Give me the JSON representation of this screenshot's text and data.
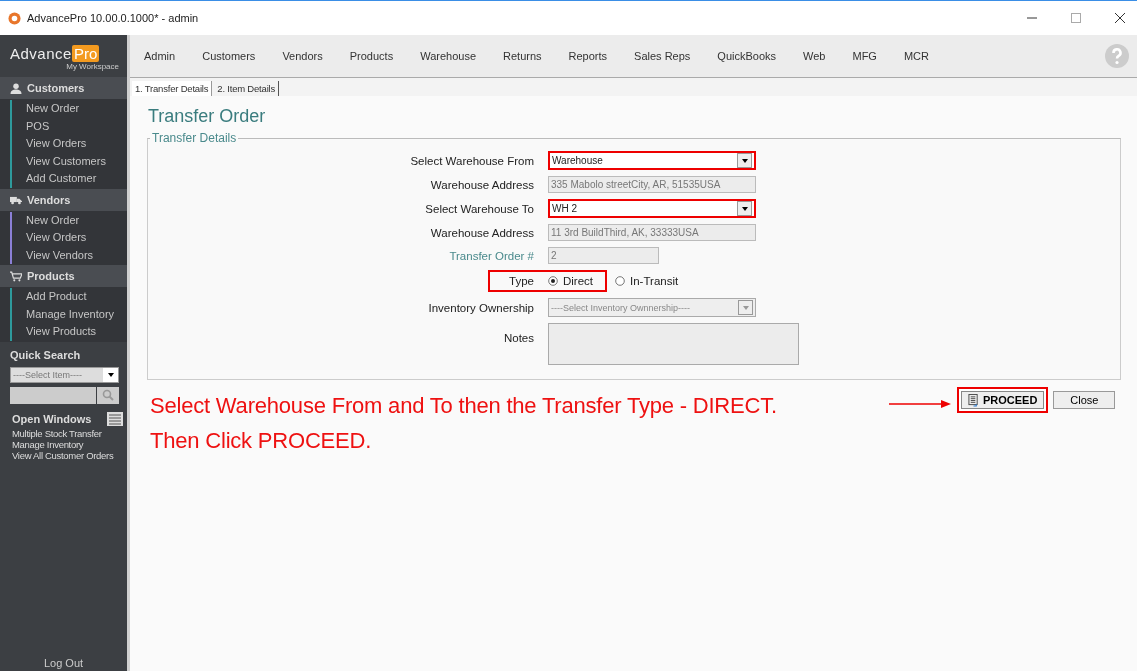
{
  "window": {
    "title": "AdvancePro 10.00.0.1000*  - admin"
  },
  "logo": {
    "word": "Advance",
    "badge": "Pro",
    "subtitle": "My Workspace"
  },
  "sidebar": {
    "sections": [
      {
        "title": "Customers",
        "color": "#2e9a9c",
        "items": [
          "New Order",
          "POS",
          "View Orders",
          "View Customers",
          "Add Customer"
        ]
      },
      {
        "title": "Vendors",
        "color": "#8b7fd6",
        "items": [
          "New Order",
          "View Orders",
          "View Vendors"
        ]
      },
      {
        "title": "Products",
        "color": "#2e9a9c",
        "items": [
          "Add Product",
          "Manage Inventory",
          "View Products"
        ]
      }
    ],
    "quick_search": {
      "title": "Quick Search",
      "placeholder": "----Select Item----"
    },
    "open_windows": {
      "title": "Open Windows",
      "items": [
        "Multiple Stock Transfer",
        "Manage Inventory",
        "View All Customer Orders"
      ]
    },
    "logout": "Log Out"
  },
  "menu": [
    "Admin",
    "Customers",
    "Vendors",
    "Products",
    "Warehouse",
    "Returns",
    "Reports",
    "Sales Reps",
    "QuickBooks",
    "Web",
    "MFG",
    "MCR"
  ],
  "tabs": [
    {
      "label": "1. Transfer Details",
      "selected": true
    },
    {
      "label": "2. Item Details",
      "selected": false
    }
  ],
  "page_title": "Transfer Order",
  "group_title": "Transfer Details",
  "form": [
    {
      "kind": "select",
      "label": "Select Warehouse From",
      "value": "Warehouse",
      "disabled": false,
      "highlighted": true
    },
    {
      "kind": "text",
      "label": "Warehouse Address",
      "value": "335 Mabolo streetCity, AR, 51535USA",
      "disabled": true,
      "highlighted": false
    },
    {
      "kind": "select",
      "label": "Select Warehouse To",
      "value": "WH 2",
      "disabled": false,
      "highlighted": true
    },
    {
      "kind": "text",
      "label": "Warehouse Address",
      "value": "11 3rd BuildThird, AK, 33333USA",
      "disabled": true,
      "highlighted": false
    },
    {
      "kind": "short",
      "label": "Transfer Order #",
      "value": "2",
      "disabled": true,
      "highlighted": false
    },
    {
      "kind": "radio",
      "label": "Type",
      "highlighted": true,
      "options": [
        {
          "label": "Direct",
          "selected": true
        },
        {
          "label": "In-Transit",
          "selected": false
        }
      ]
    },
    {
      "kind": "select",
      "label": "Inventory Ownership",
      "value": "----Select Inventory Ownnership----",
      "disabled": true,
      "highlighted": false
    },
    {
      "kind": "notes",
      "label": "Notes",
      "disabled": true,
      "highlighted": false
    }
  ],
  "instruction": [
    "Select Warehouse From and To then the Transfer Type - DIRECT.",
    "Then Click PROCEED."
  ],
  "buttons": [
    {
      "label": "PROCEED",
      "kind": "primary",
      "highlighted": true
    },
    {
      "label": "Close",
      "kind": "plain"
    }
  ]
}
